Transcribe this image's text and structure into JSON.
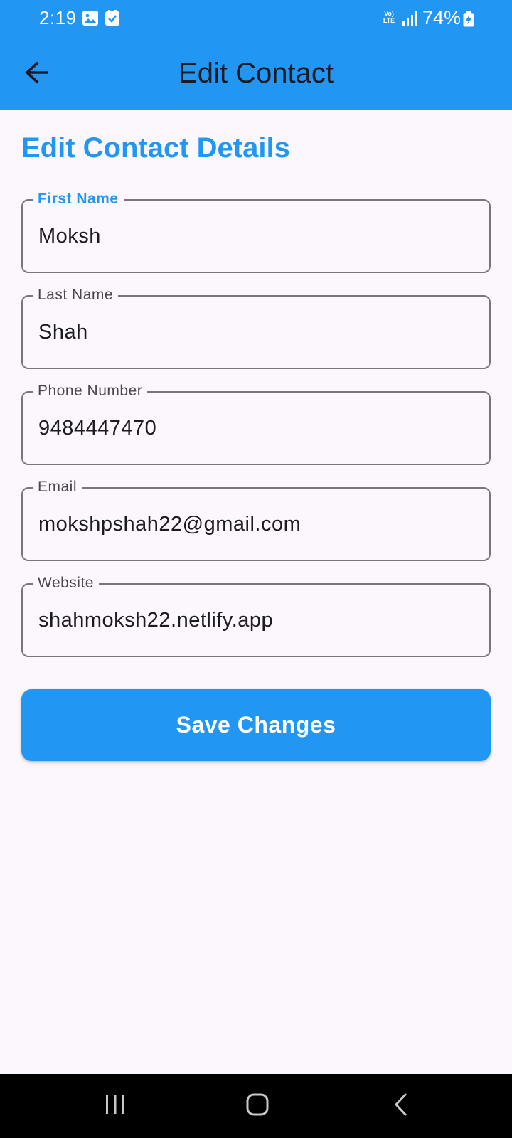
{
  "status_bar": {
    "time": "2:19",
    "network": "LTE",
    "battery": "74%"
  },
  "app_bar": {
    "title": "Edit Contact",
    "back_icon": "arrow-left-icon"
  },
  "form": {
    "heading": "Edit Contact Details",
    "fields": [
      {
        "label": "First Name",
        "value": "Moksh",
        "focused": true
      },
      {
        "label": "Last Name",
        "value": "Shah"
      },
      {
        "label": "Phone Number",
        "value": "9484447470"
      },
      {
        "label": "Email",
        "value": "mokshpshah22@gmail.com"
      },
      {
        "label": "Website",
        "value": "shahmoksh22.netlify.app"
      }
    ],
    "save_label": "Save Changes"
  },
  "nav_bar": {
    "recents_icon": "recents-icon",
    "home_icon": "home-icon",
    "back_icon": "nav-back-icon"
  },
  "colors": {
    "primary": "#2196F3",
    "background": "#FCF6FD",
    "outline": "#79747E"
  }
}
